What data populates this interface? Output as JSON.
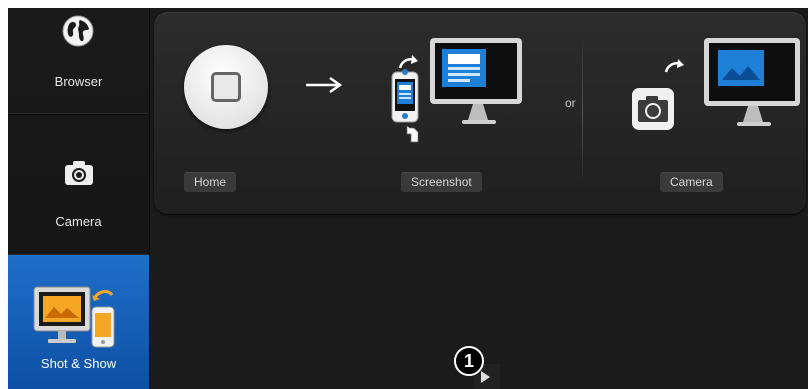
{
  "sidebar": {
    "items": [
      {
        "label": "Browser",
        "icon": "globe-icon"
      },
      {
        "label": "Camera",
        "icon": "camera-icon"
      },
      {
        "label": "Shot & Show",
        "icon": "shot-show-icon",
        "selected": true
      }
    ]
  },
  "steps": {
    "home_label": "Home",
    "screenshot_label": "Screenshot",
    "or_label": "or",
    "camera_label": "Camera"
  },
  "callout": {
    "number": "1"
  },
  "colors": {
    "accent": "#1565c0",
    "screen_blue": "#1e7fd6"
  }
}
